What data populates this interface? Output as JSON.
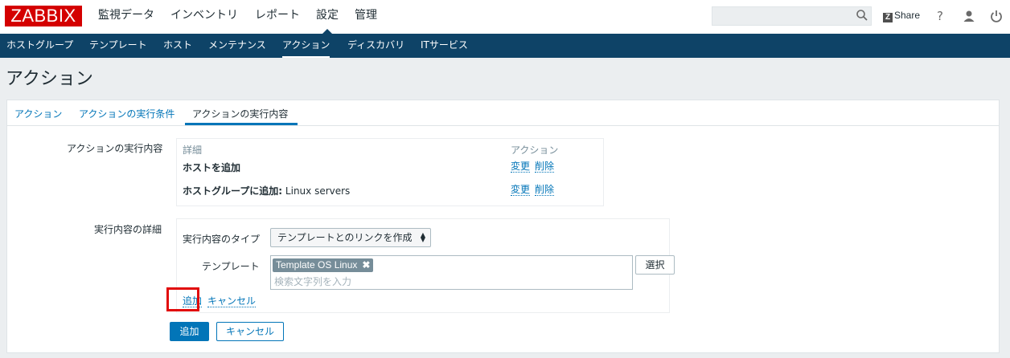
{
  "header": {
    "logo": "ZABBIX",
    "menu": [
      {
        "label": "監視データ"
      },
      {
        "label": "インベントリ"
      },
      {
        "label": "レポート"
      },
      {
        "label": "設定",
        "active": true
      },
      {
        "label": "管理"
      }
    ],
    "search_value": "",
    "share_label": "Share",
    "icons": [
      "search-icon",
      "help-icon",
      "user-icon",
      "power-icon"
    ]
  },
  "subnav": {
    "items": [
      {
        "label": "ホストグループ"
      },
      {
        "label": "テンプレート"
      },
      {
        "label": "ホスト"
      },
      {
        "label": "メンテナンス"
      },
      {
        "label": "アクション",
        "active": true
      },
      {
        "label": "ディスカバリ"
      },
      {
        "label": "ITサービス"
      }
    ]
  },
  "page_title": "アクション",
  "tabs": [
    {
      "label": "アクション"
    },
    {
      "label": "アクションの実行条件"
    },
    {
      "label": "アクションの実行内容",
      "active": true
    }
  ],
  "form": {
    "operations_label": "アクションの実行内容",
    "details_label": "実行内容の詳細",
    "ops_table": {
      "col_details": "詳細",
      "col_action": "アクション",
      "rows": [
        {
          "desc_bold": "ホストを追加",
          "desc_rest": "",
          "edit": "変更",
          "remove": "削除"
        },
        {
          "desc_bold": "ホストグループに追加:",
          "desc_rest": "Linux servers",
          "edit": "変更",
          "remove": "削除"
        }
      ]
    },
    "details": {
      "type_label": "実行内容のタイプ",
      "type_value": "テンプレートとのリンクを作成",
      "template_label": "テンプレート",
      "chip": "Template OS Linux",
      "chip_remove": "✖",
      "search_placeholder": "検索文字列を入力",
      "select_button": "選択",
      "add_link": "追加",
      "cancel_link": "キャンセル"
    },
    "buttons": {
      "add": "追加",
      "cancel": "キャンセル"
    }
  },
  "colors": {
    "brand": "#d40000",
    "nav": "#0e4367",
    "link": "#0275b8",
    "highlight": "#e10a0a"
  }
}
